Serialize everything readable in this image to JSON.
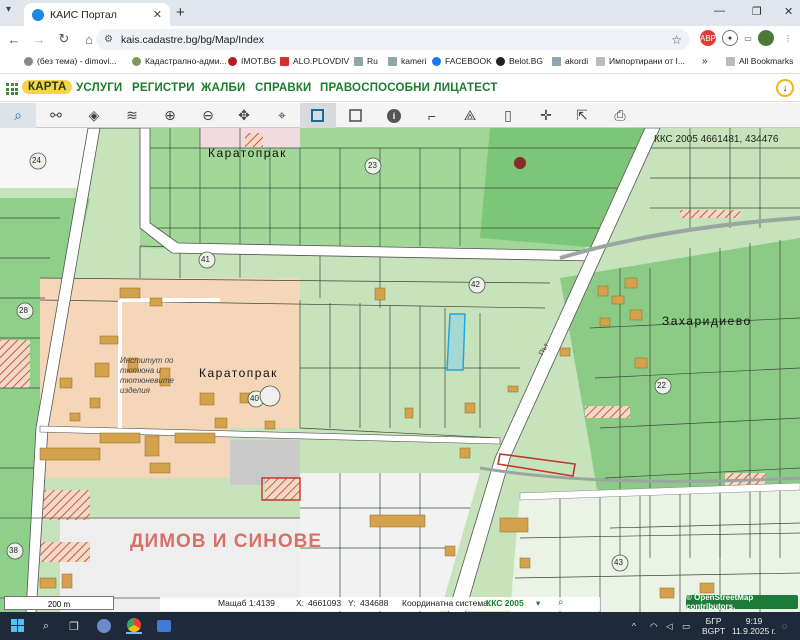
{
  "browser": {
    "tab_title": "КАИС Портал",
    "url": "kais.cadastre.bg/bg/Map/Index",
    "bookmarks": [
      "(без тема) - dimovi...",
      "Кадастрално-адми...",
      "IMOT.BG",
      "ALO.PLOVDIV",
      "Ru",
      "kameri",
      "FACEBOOK",
      "Belot.BG",
      "akordi",
      "Импортирани от I...",
      "All Bookmarks"
    ]
  },
  "site_nav": {
    "items": [
      "КАРТА",
      "УСЛУГИ",
      "РЕГИСТРИ",
      "ЖАЛБИ",
      "СПРАВКИ",
      "ПРАВОСПОСОБНИ ЛИЦА",
      "ТЕСТ"
    ]
  },
  "map": {
    "coord_header": "ККС 2005 4661481, 434476",
    "place_labels": [
      "Каратопрак",
      "Каратопрак",
      "Захаридиево"
    ],
    "area_labels": [
      "Институт по тютюна и тютюневите изделия"
    ],
    "watermark": "ДИМОВ И СИНОВЕ",
    "road_label": "Път",
    "numbers": [
      "24",
      "23",
      "41",
      "42",
      "28",
      "40",
      "22",
      "38",
      "43"
    ],
    "scale_text": "200 m"
  },
  "status": {
    "scale_label": "Мащаб 1:",
    "scale_value": "4139",
    "x_label": "X:",
    "x_value": "4661093",
    "y_label": "Y:",
    "y_value": "434688",
    "cs_label": "Координатна система:",
    "cs_value": "ККС 2005",
    "osm_credit": "© OpenStreetMap contributors."
  },
  "taskbar": {
    "lang": "БГР",
    "lang2": "BGPT",
    "time": "9:19",
    "date": "11.9.2025 г."
  }
}
